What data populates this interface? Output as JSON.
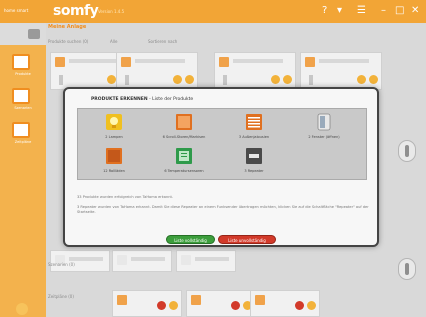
{
  "topbar": {
    "brand": "home smart",
    "logo": "somfy",
    "version": "Version 1.4.5",
    "icons": [
      "help-icon",
      "user-icon",
      "menu-icon",
      "minimize-icon",
      "maximize-icon",
      "close-icon"
    ]
  },
  "sidebar": {
    "items": [
      {
        "label": "Produkte",
        "icon": "product-icon"
      },
      {
        "label": "Szenarien",
        "icon": "scenario-icon"
      },
      {
        "label": "Zeitpläne",
        "icon": "schedule-icon"
      }
    ]
  },
  "workspace": {
    "title": "Meine Anlage",
    "tools": {
      "left": "Produkte suchen (0)",
      "mid": "Alle",
      "right": "Sortieren nach"
    },
    "sections": [
      {
        "label": "Szenarien (0)"
      },
      {
        "label": "Zeitpläne (0)"
      }
    ]
  },
  "modal": {
    "title_bold": "PRODUKTE ERKENNEN",
    "title_rest": " - Liste der Produkte",
    "products": [
      {
        "caption": "2 Lampen",
        "icon": "lamp-icon",
        "color": "#f0c020"
      },
      {
        "caption": "6 Scroll-Storen/Markisen",
        "icon": "awning-icon",
        "color": "#e07020"
      },
      {
        "caption": "3 Außenjalousien",
        "icon": "blind-icon",
        "color": "#e07020"
      },
      {
        "caption": "2 Fenster (öffnen)",
        "icon": "window-icon",
        "color": "#e8e8e8"
      },
      {
        "caption": "12 Rollläden",
        "icon": "shutter-icon",
        "color": "#e07020"
      },
      {
        "caption": "6 Temperatursensoren",
        "icon": "sensor-icon",
        "color": "#2e9a4a"
      },
      {
        "caption": "3 Repeater",
        "icon": "repeater-icon",
        "color": "#4a4a4a"
      }
    ],
    "note1": "33 Produkte wurden erfolgreich von TaHoma erkannt.",
    "note2": "3 Repeater wurden von TaHoma erkannt. Damit Sie diese Repeater an einem Funksender übertragen möchten, klicken Sie auf die Schaltfläche \"Repeater\" auf der Startseite.",
    "btn_complete": "Liste vollständig",
    "btn_incomplete": "Liste unvollständig"
  }
}
